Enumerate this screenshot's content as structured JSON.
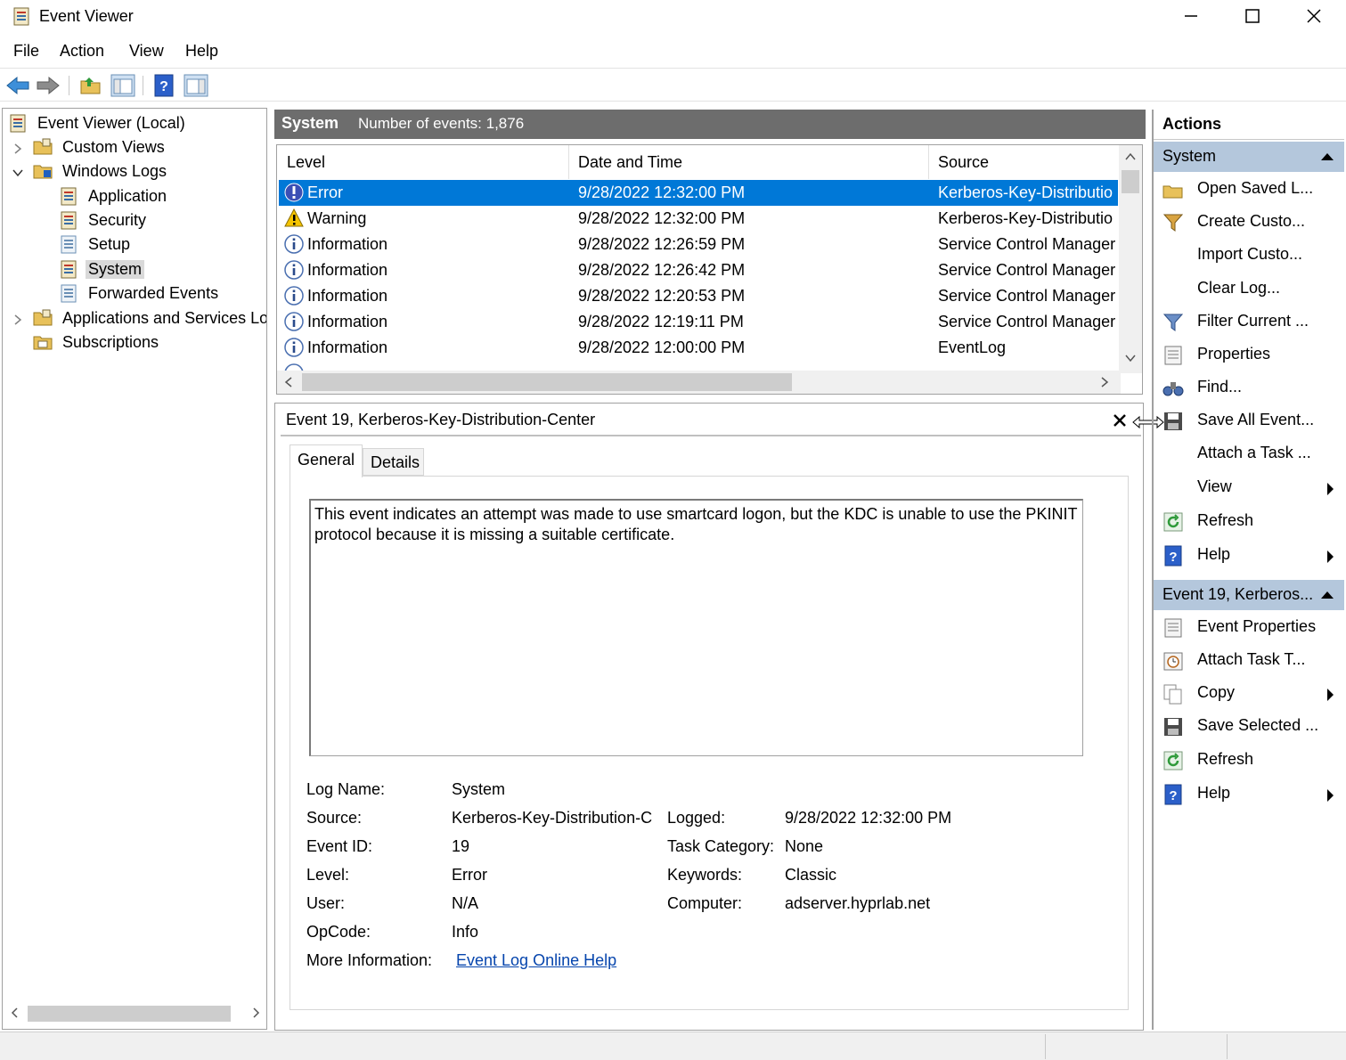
{
  "window": {
    "title": "Event Viewer"
  },
  "menu": [
    "File",
    "Action",
    "View",
    "Help"
  ],
  "tree": {
    "root": "Event Viewer (Local)",
    "custom_views": "Custom Views",
    "windows_logs": "Windows Logs",
    "application": "Application",
    "security": "Security",
    "setup": "Setup",
    "system": "System",
    "forwarded": "Forwarded Events",
    "apps_services": "Applications and Services Lo",
    "subscriptions": "Subscriptions"
  },
  "log_header": {
    "name": "System",
    "count_text": "Number of events: 1,876"
  },
  "grid": {
    "columns": [
      "Level",
      "Date and Time",
      "Source"
    ],
    "rows": [
      {
        "level": "Error",
        "icon": "error-icon",
        "datetime": "9/28/2022 12:32:00 PM",
        "source": "Kerberos-Key-Distributio"
      },
      {
        "level": "Warning",
        "icon": "warning-icon",
        "datetime": "9/28/2022 12:32:00 PM",
        "source": "Kerberos-Key-Distributio"
      },
      {
        "level": "Information",
        "icon": "info-icon",
        "datetime": "9/28/2022 12:26:59 PM",
        "source": "Service Control Manager"
      },
      {
        "level": "Information",
        "icon": "info-icon",
        "datetime": "9/28/2022 12:26:42 PM",
        "source": "Service Control Manager"
      },
      {
        "level": "Information",
        "icon": "info-icon",
        "datetime": "9/28/2022 12:20:53 PM",
        "source": "Service Control Manager"
      },
      {
        "level": "Information",
        "icon": "info-icon",
        "datetime": "9/28/2022 12:19:11 PM",
        "source": "Service Control Manager"
      },
      {
        "level": "Information",
        "icon": "info-icon",
        "datetime": "9/28/2022 12:00:00 PM",
        "source": "EventLog"
      }
    ]
  },
  "detail": {
    "title": "Event 19, Kerberos-Key-Distribution-Center",
    "tabs": [
      "General",
      "Details"
    ],
    "description": "This event indicates an attempt was made to use smartcard logon, but the KDC is unable to use the PKINIT protocol because it is missing a suitable certificate.",
    "labels": {
      "log_name": "Log Name:",
      "source": "Source:",
      "event_id": "Event ID:",
      "level": "Level:",
      "user": "User:",
      "opcode": "OpCode:",
      "more_info": "More Information:",
      "logged": "Logged:",
      "task_category": "Task Category:",
      "keywords": "Keywords:",
      "computer": "Computer:"
    },
    "values": {
      "log_name": "System",
      "source": "Kerberos-Key-Distribution-C",
      "event_id": "19",
      "level": "Error",
      "user": "N/A",
      "opcode": "Info",
      "more_info": "Event Log Online Help",
      "logged": "9/28/2022 12:32:00 PM",
      "task_category": "None",
      "keywords": "Classic",
      "computer": "adserver.hyprlab.net"
    }
  },
  "actions": {
    "header": "Actions",
    "section1": "System",
    "items1": [
      "Open Saved L...",
      "Create Custo...",
      "Import Custo...",
      "Clear Log...",
      "Filter Current ...",
      "Properties",
      "Find...",
      "Save All Event...",
      "Attach a Task ...",
      "View",
      "Refresh",
      "Help"
    ],
    "section2": "Event 19, Kerberos...",
    "items2": [
      "Event Properties",
      "Attach Task T...",
      "Copy",
      "Save Selected ...",
      "Refresh",
      "Help"
    ]
  },
  "colors": {
    "selection": "#0078d7",
    "header_bar": "#6d6d6d",
    "section_bar": "#b4c7dc",
    "link": "#0645ad"
  }
}
